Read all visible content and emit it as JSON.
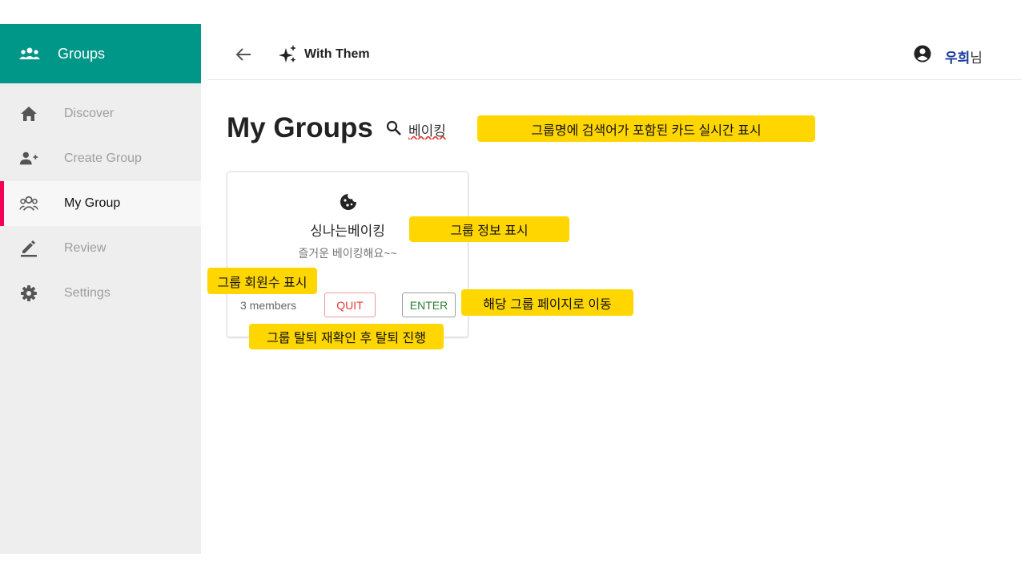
{
  "sidebar": {
    "title": "Groups",
    "title_icon": "groups-icon",
    "items": [
      {
        "label": "Discover",
        "icon": "home-icon"
      },
      {
        "label": "Create Group",
        "icon": "person-add-icon"
      },
      {
        "label": "My Group",
        "icon": "people-icon",
        "active": true
      },
      {
        "label": "Review",
        "icon": "edit-icon"
      },
      {
        "label": "Settings",
        "icon": "gear-icon"
      }
    ]
  },
  "header": {
    "brand": "With Them",
    "brand_icon": "sparkle-icon",
    "username": "우희",
    "username_suffix": "님"
  },
  "main": {
    "title": "My Groups",
    "search_value": "베이킹"
  },
  "card": {
    "name": "싱나는베이킹",
    "description": "즐거운 베이킹해요~~",
    "members": "3 members",
    "quit_label": "QUIT",
    "enter_label": "ENTER",
    "icon": "cookie-icon"
  },
  "annotations": {
    "search_note": "그룹명에 검색어가 포함된 카드 실시간 표시",
    "info_note": "그룹 정보 표시",
    "members_note": "그룹 회원수 표시",
    "enter_note": "해당 그룹 페이지로 이동",
    "quit_note": "그룹 탈퇴 재확인 후 탈퇴 진행"
  },
  "colors": {
    "sidebar_header": "#009688",
    "active_indicator": "#f50057",
    "annotation": "#ffd600",
    "quit": "#e53935",
    "enter": "#2e7d32",
    "username": "#1a3a9e"
  }
}
